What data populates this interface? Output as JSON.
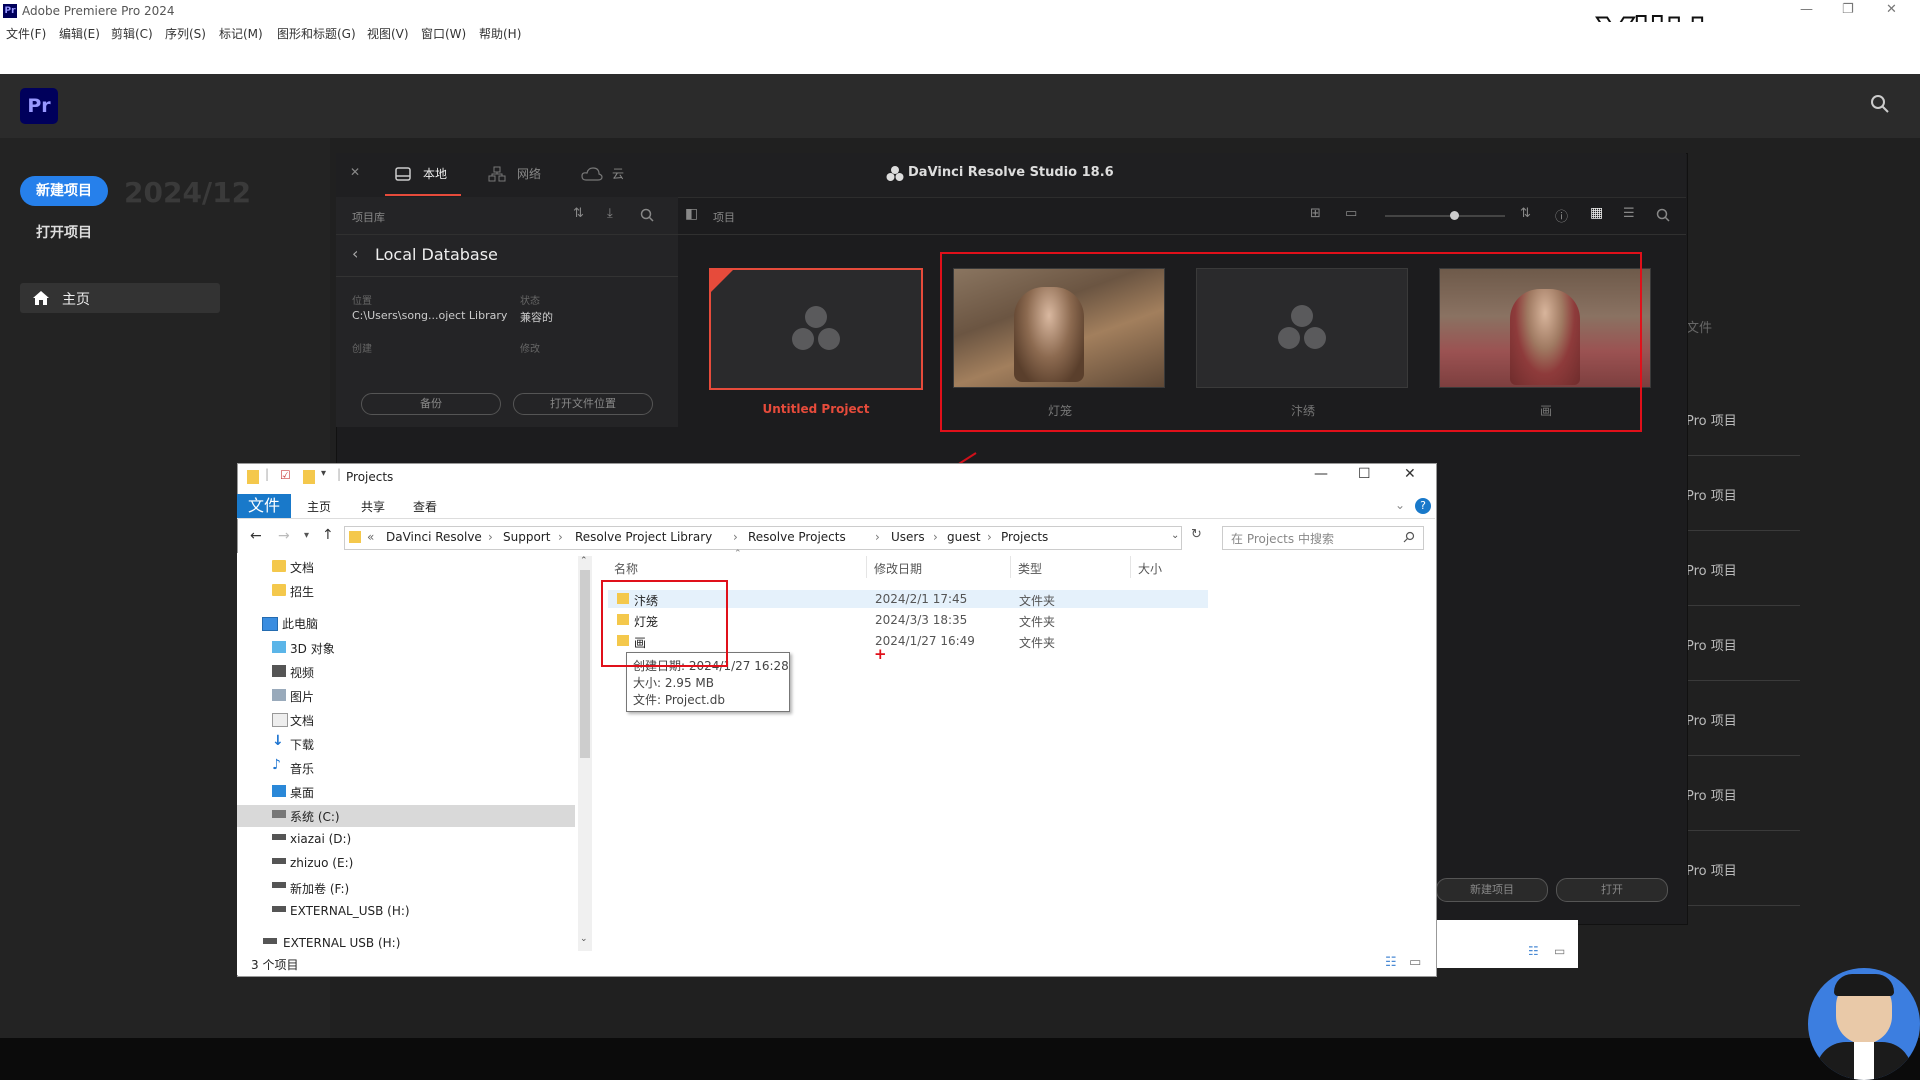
{
  "window": {
    "title": "Adobe Premiere Pro 2024",
    "watermark": "YiiHuu.com",
    "menu": [
      "文件(F)",
      "编辑(E)",
      "剪辑(C)",
      "序列(S)",
      "标记(M)",
      "图形和标题(G)",
      "视图(V)",
      "窗口(W)",
      "帮助(H)"
    ]
  },
  "premiere": {
    "logo": "Pr",
    "new_project": "新建项目",
    "open_project": "打开项目",
    "ghost_text": "2024/12",
    "home": "主页",
    "files_header": "文件",
    "pro_items": [
      "Pro 项目",
      "Pro 项目",
      "Pro 项目",
      "Pro 项目",
      "Pro 项目",
      "Pro 项目",
      "Pro 项目"
    ],
    "bottom_buttons": {
      "new": "新建项目",
      "open": "打开"
    }
  },
  "davinci": {
    "title": "DaVinci Resolve Studio 18.6",
    "tabs": [
      "本地",
      "网络",
      "云"
    ],
    "library_label": "项目库",
    "projects_label": "项目",
    "database": "Local Database",
    "location_label": "位置",
    "location_value": "C:\\Users\\song...oject Library",
    "status_label": "状态",
    "status_value": "兼容的",
    "created_label": "创建",
    "modified_label": "修改",
    "backup_button": "备份",
    "open_location_button": "打开文件位置",
    "projects": [
      {
        "name": "Untitled Project",
        "selected": true,
        "thumbnail": "resolve-logo"
      },
      {
        "name": "灯笼",
        "selected": false,
        "thumbnail": "video-frame"
      },
      {
        "name": "汴绣",
        "selected": false,
        "thumbnail": "resolve-logo"
      },
      {
        "name": "画",
        "selected": false,
        "thumbnail": "video-frame"
      }
    ],
    "accent_color": "#e64b3b"
  },
  "explorer": {
    "title": "Projects",
    "ribbon_tabs": [
      "文件",
      "主页",
      "共享",
      "查看"
    ],
    "breadcrumb": [
      "DaVinci Resolve",
      "Support",
      "Resolve Project Library",
      "Resolve Projects",
      "Users",
      "guest",
      "Projects"
    ],
    "breadcrumb_prefix": "«",
    "search_placeholder": "在 Projects 中搜索",
    "nav_items": [
      {
        "label": "文档",
        "icon": "folder-icon"
      },
      {
        "label": "招生",
        "icon": "folder-icon"
      },
      {
        "label": "此电脑",
        "icon": "pc-icon"
      },
      {
        "label": "3D 对象",
        "icon": "cube-icon"
      },
      {
        "label": "视频",
        "icon": "video-icon"
      },
      {
        "label": "图片",
        "icon": "picture-icon"
      },
      {
        "label": "文档",
        "icon": "document-icon"
      },
      {
        "label": "下载",
        "icon": "download-icon"
      },
      {
        "label": "音乐",
        "icon": "music-icon"
      },
      {
        "label": "桌面",
        "icon": "desktop-icon"
      },
      {
        "label": "系统 (C:)",
        "icon": "drive-icon"
      },
      {
        "label": "xiazai (D:)",
        "icon": "drive-icon"
      },
      {
        "label": "zhizuo (E:)",
        "icon": "drive-icon"
      },
      {
        "label": "新加卷 (F:)",
        "icon": "drive-icon"
      },
      {
        "label": "EXTERNAL_USB (H:)",
        "icon": "usb-drive-icon"
      },
      {
        "label": "EXTERNAL USB (H:)",
        "icon": "usb-drive-icon"
      }
    ],
    "columns": [
      "名称",
      "修改日期",
      "类型",
      "大小"
    ],
    "files": [
      {
        "name": "汴绣",
        "date": "2024/2/1 17:45",
        "type": "文件夹",
        "size": ""
      },
      {
        "name": "灯笼",
        "date": "2024/3/3 18:35",
        "type": "文件夹",
        "size": ""
      },
      {
        "name": "画",
        "date": "2024/1/27 16:49",
        "type": "文件夹",
        "size": ""
      }
    ],
    "tooltip": {
      "created": "创建日期: 2024/1/27 16:28",
      "size": "大小: 2.95 MB",
      "files": "文件: Project.db"
    },
    "status": "3 个项目"
  }
}
